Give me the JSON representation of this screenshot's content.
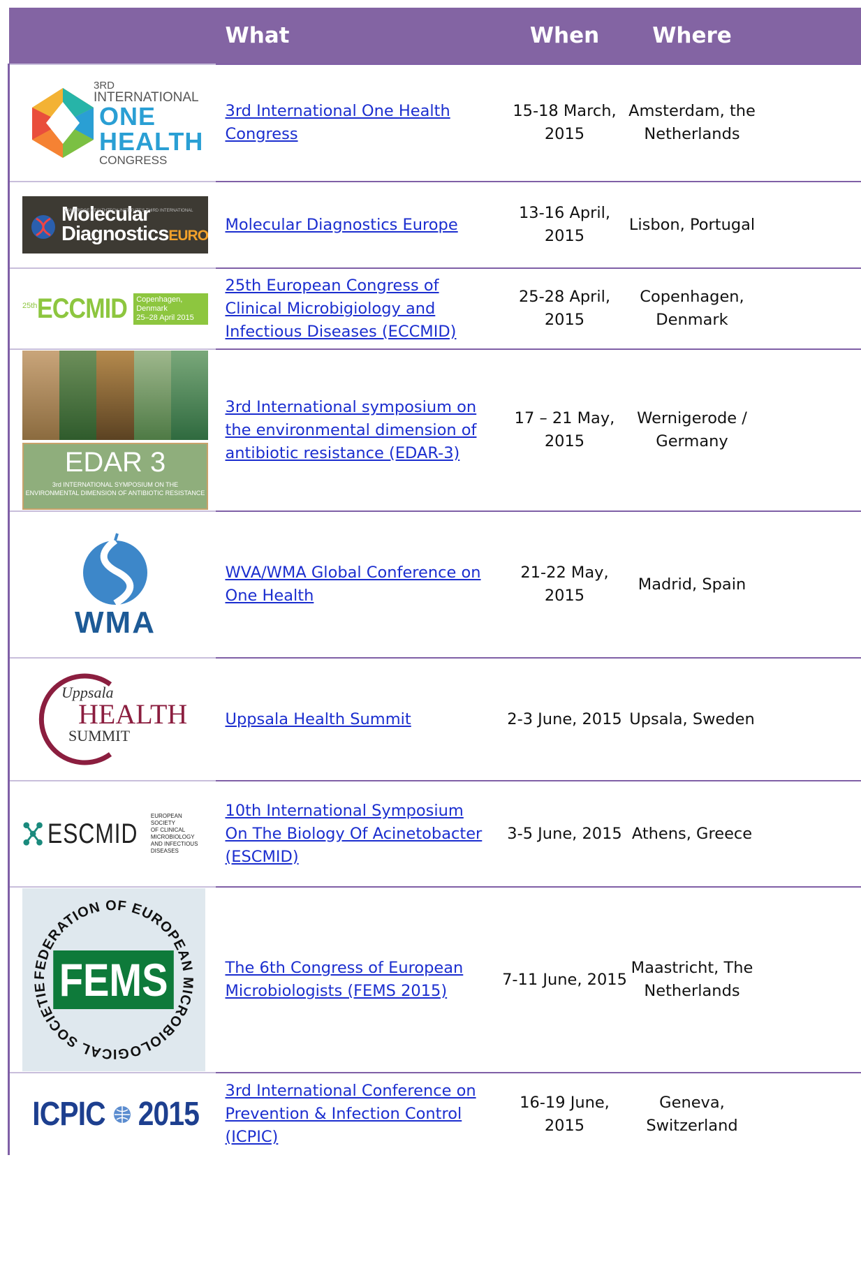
{
  "header": {
    "what": "What",
    "when": "When",
    "where": "Where"
  },
  "events": [
    {
      "title": "3rd International One Health Congress",
      "when": "15-18 March, 2015",
      "where": "Amsterdam, the Netherlands",
      "logo": {
        "icon": "one-health-logo",
        "line1": "3RD",
        "line2": "INTERNATIONAL",
        "line3": "ONE",
        "line4": "HEALTH",
        "line5": "CONGRESS"
      }
    },
    {
      "title": "Molecular Diagnostics Europe",
      "when": "13-16 April, 2015",
      "where": "Lisbon, Portugal",
      "logo": {
        "icon": "molecular-diagnostics-logo",
        "line1": "CAMBRIDGE HEALTHTECH INSTITUTE'S THIRD INTERNATIONAL",
        "line2": "Molecular",
        "line3": "Diagnostics",
        "line4": "EUROPE"
      }
    },
    {
      "title": "25th European Congress of Clinical Microbigiology and Infectious Diseases (ECCMID)",
      "when": "25-28 April, 2015",
      "where": "Copenhagen, Denmark",
      "logo": {
        "icon": "eccmid-logo",
        "line1": "25th",
        "line2": "ECCMID",
        "line3": "Copenhagen, Denmark",
        "line4": "25–28 April 2015"
      }
    },
    {
      "title": "3rd International symposium on the environmental dimension of antibiotic resistance (EDAR-3)",
      "when": "17 – 21 May, 2015",
      "where": "Wernigerode / Germany",
      "logo": {
        "icon": "edar-logo",
        "line1": "EDAR 3",
        "line2": "3rd INTERNATIONAL SYMPOSIUM ON THE",
        "line3": "ENVIRONMENTAL DIMENSION OF ANTIBIOTIC RESISTANCE"
      }
    },
    {
      "title": "WVA/WMA Global Conference on One Health",
      "when": "21-22 May, 2015",
      "where": "Madrid, Spain",
      "logo": {
        "icon": "wma-logo",
        "line1": "WMA"
      }
    },
    {
      "title": "Uppsala Health Summit",
      "when": "2-3 June, 2015",
      "where": "Upsala, Sweden",
      "logo": {
        "icon": "uppsala-health-summit-logo",
        "line1": "Uppsala",
        "line2": "HEALTH",
        "line3": "SUMMIT"
      }
    },
    {
      "title": "10th International Symposium On The Biology Of Acinetobacter (ESCMID)",
      "when": "3-5 June, 2015",
      "where": "Athens, Greece",
      "logo": {
        "icon": "escmid-logo",
        "line1": "ESCMID",
        "line2": "EUROPEAN SOCIETY",
        "line3": "OF CLINICAL MICROBIOLOGY",
        "line4": "AND INFECTIOUS DISEASES"
      }
    },
    {
      "title": "The 6th Congress of European Microbiologists (FEMS 2015)",
      "when": "7-11 June, 2015",
      "where": "Maastricht, The Netherlands",
      "logo": {
        "icon": "fems-logo",
        "line1": "FEMS",
        "line2": "FEDERATION OF EUROPEAN MICROBIOLOGICAL SOCIETIES"
      }
    },
    {
      "title": "3rd International Conference on Prevention & Infection Control (ICPIC)",
      "when": "16-19 June, 2015",
      "where": "Geneva, Switzerland",
      "logo": {
        "icon": "icpic-logo",
        "line1": "ICPIC",
        "line2": "2015"
      }
    }
  ]
}
